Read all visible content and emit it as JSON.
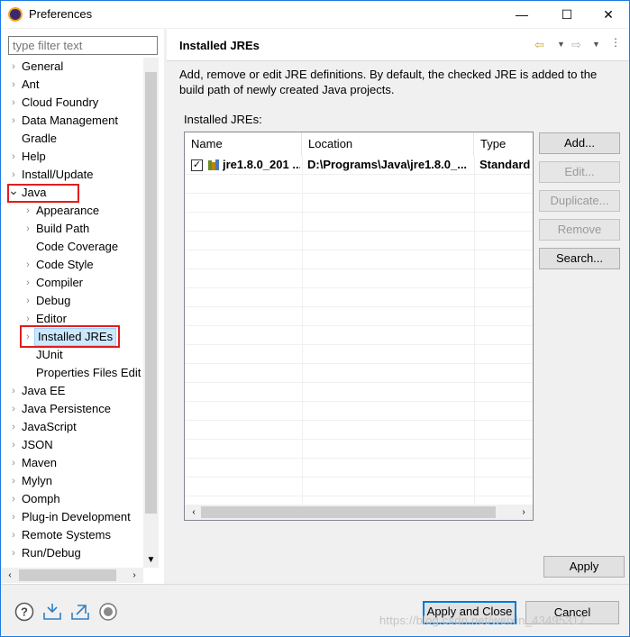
{
  "window": {
    "title": "Preferences",
    "minimize_icon": "minimize-icon",
    "maximize_icon": "maximize-icon",
    "close_icon": "close-icon"
  },
  "filter": {
    "placeholder": "type filter text"
  },
  "tree": {
    "items": [
      {
        "label": "General",
        "level": 0,
        "expander": "collapsed"
      },
      {
        "label": "Ant",
        "level": 0,
        "expander": "collapsed"
      },
      {
        "label": "Cloud Foundry",
        "level": 0,
        "expander": "collapsed"
      },
      {
        "label": "Data Management",
        "level": 0,
        "expander": "collapsed"
      },
      {
        "label": "Gradle",
        "level": 0,
        "expander": "none"
      },
      {
        "label": "Help",
        "level": 0,
        "expander": "collapsed"
      },
      {
        "label": "Install/Update",
        "level": 0,
        "expander": "collapsed"
      },
      {
        "label": "Java",
        "level": 0,
        "expander": "expanded"
      },
      {
        "label": "Appearance",
        "level": 1,
        "expander": "collapsed"
      },
      {
        "label": "Build Path",
        "level": 1,
        "expander": "collapsed"
      },
      {
        "label": "Code Coverage",
        "level": 1,
        "expander": "none"
      },
      {
        "label": "Code Style",
        "level": 1,
        "expander": "collapsed"
      },
      {
        "label": "Compiler",
        "level": 1,
        "expander": "collapsed"
      },
      {
        "label": "Debug",
        "level": 1,
        "expander": "collapsed"
      },
      {
        "label": "Editor",
        "level": 1,
        "expander": "collapsed"
      },
      {
        "label": "Installed JREs",
        "level": 1,
        "expander": "collapsed",
        "selected": true
      },
      {
        "label": "JUnit",
        "level": 1,
        "expander": "none"
      },
      {
        "label": "Properties Files Edit",
        "level": 1,
        "expander": "none"
      },
      {
        "label": "Java EE",
        "level": 0,
        "expander": "collapsed"
      },
      {
        "label": "Java Persistence",
        "level": 0,
        "expander": "collapsed"
      },
      {
        "label": "JavaScript",
        "level": 0,
        "expander": "collapsed"
      },
      {
        "label": "JSON",
        "level": 0,
        "expander": "collapsed"
      },
      {
        "label": "Maven",
        "level": 0,
        "expander": "collapsed"
      },
      {
        "label": "Mylyn",
        "level": 0,
        "expander": "collapsed"
      },
      {
        "label": "Oomph",
        "level": 0,
        "expander": "collapsed"
      },
      {
        "label": "Plug-in Development",
        "level": 0,
        "expander": "collapsed"
      },
      {
        "label": "Remote Systems",
        "level": 0,
        "expander": "collapsed"
      },
      {
        "label": "Run/Debug",
        "level": 0,
        "expander": "collapsed"
      }
    ]
  },
  "page": {
    "title": "Installed JREs",
    "back_icon": "back-arrow-icon",
    "forward_icon": "forward-arrow-icon",
    "description": "Add, remove or edit JRE definitions. By default, the checked JRE is added to the build path of newly created Java projects.",
    "list_label": "Installed JREs:"
  },
  "table": {
    "columns": [
      "Name",
      "Location",
      "Type"
    ],
    "rows": [
      {
        "checked": true,
        "name": "jre1.8.0_201 ...",
        "location": "D:\\Programs\\Java\\jre1.8.0_...",
        "type": "Standard"
      }
    ]
  },
  "buttons": {
    "add": "Add...",
    "edit": "Edit...",
    "duplicate": "Duplicate...",
    "remove": "Remove",
    "search": "Search...",
    "apply": "Apply",
    "apply_close": "Apply and Close",
    "cancel": "Cancel"
  },
  "bottom_icons": [
    "help-icon",
    "import-icon",
    "export-icon",
    "record-icon"
  ],
  "watermark": "https://blog.csdn.net/weixin_43495317",
  "colors": {
    "selection": "#cce8ff",
    "highlight_box": "#e11d1d",
    "default_button_border": "#0078d7"
  }
}
